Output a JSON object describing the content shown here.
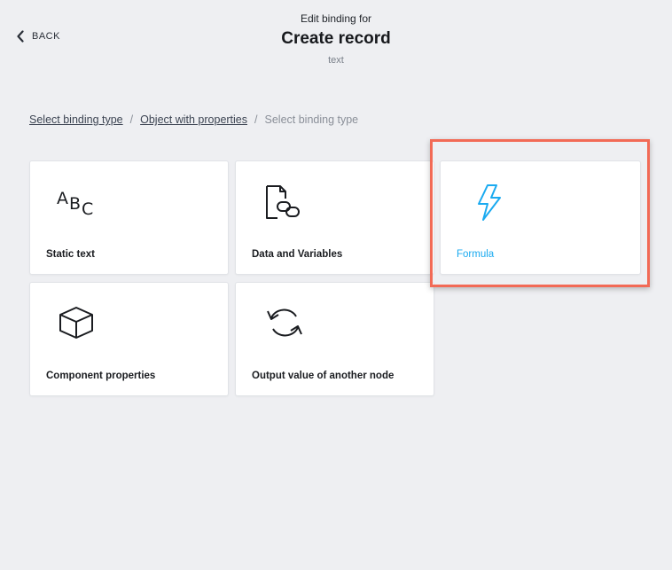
{
  "nav": {
    "back_label": "BACK"
  },
  "header": {
    "subtitle": "Edit binding for",
    "title": "Create record",
    "meta": "text"
  },
  "breadcrumb": {
    "items": [
      {
        "label": "Select binding type"
      },
      {
        "label": "Object with properties"
      },
      {
        "label": "Select binding type"
      }
    ],
    "separator": "/"
  },
  "cards": [
    {
      "label": "Static text",
      "icon": "abc-text-icon"
    },
    {
      "label": "Data and Variables",
      "icon": "document-link-icon"
    },
    {
      "label": "Formula",
      "icon": "lightning-bolt-icon",
      "selected": true
    },
    {
      "label": "Component properties",
      "icon": "cube-icon"
    },
    {
      "label": "Output value of another node",
      "icon": "refresh-cycle-icon"
    }
  ],
  "colors": {
    "background": "#eeeff2",
    "accent": "#1aaaf0",
    "highlight": "#f26a56"
  }
}
